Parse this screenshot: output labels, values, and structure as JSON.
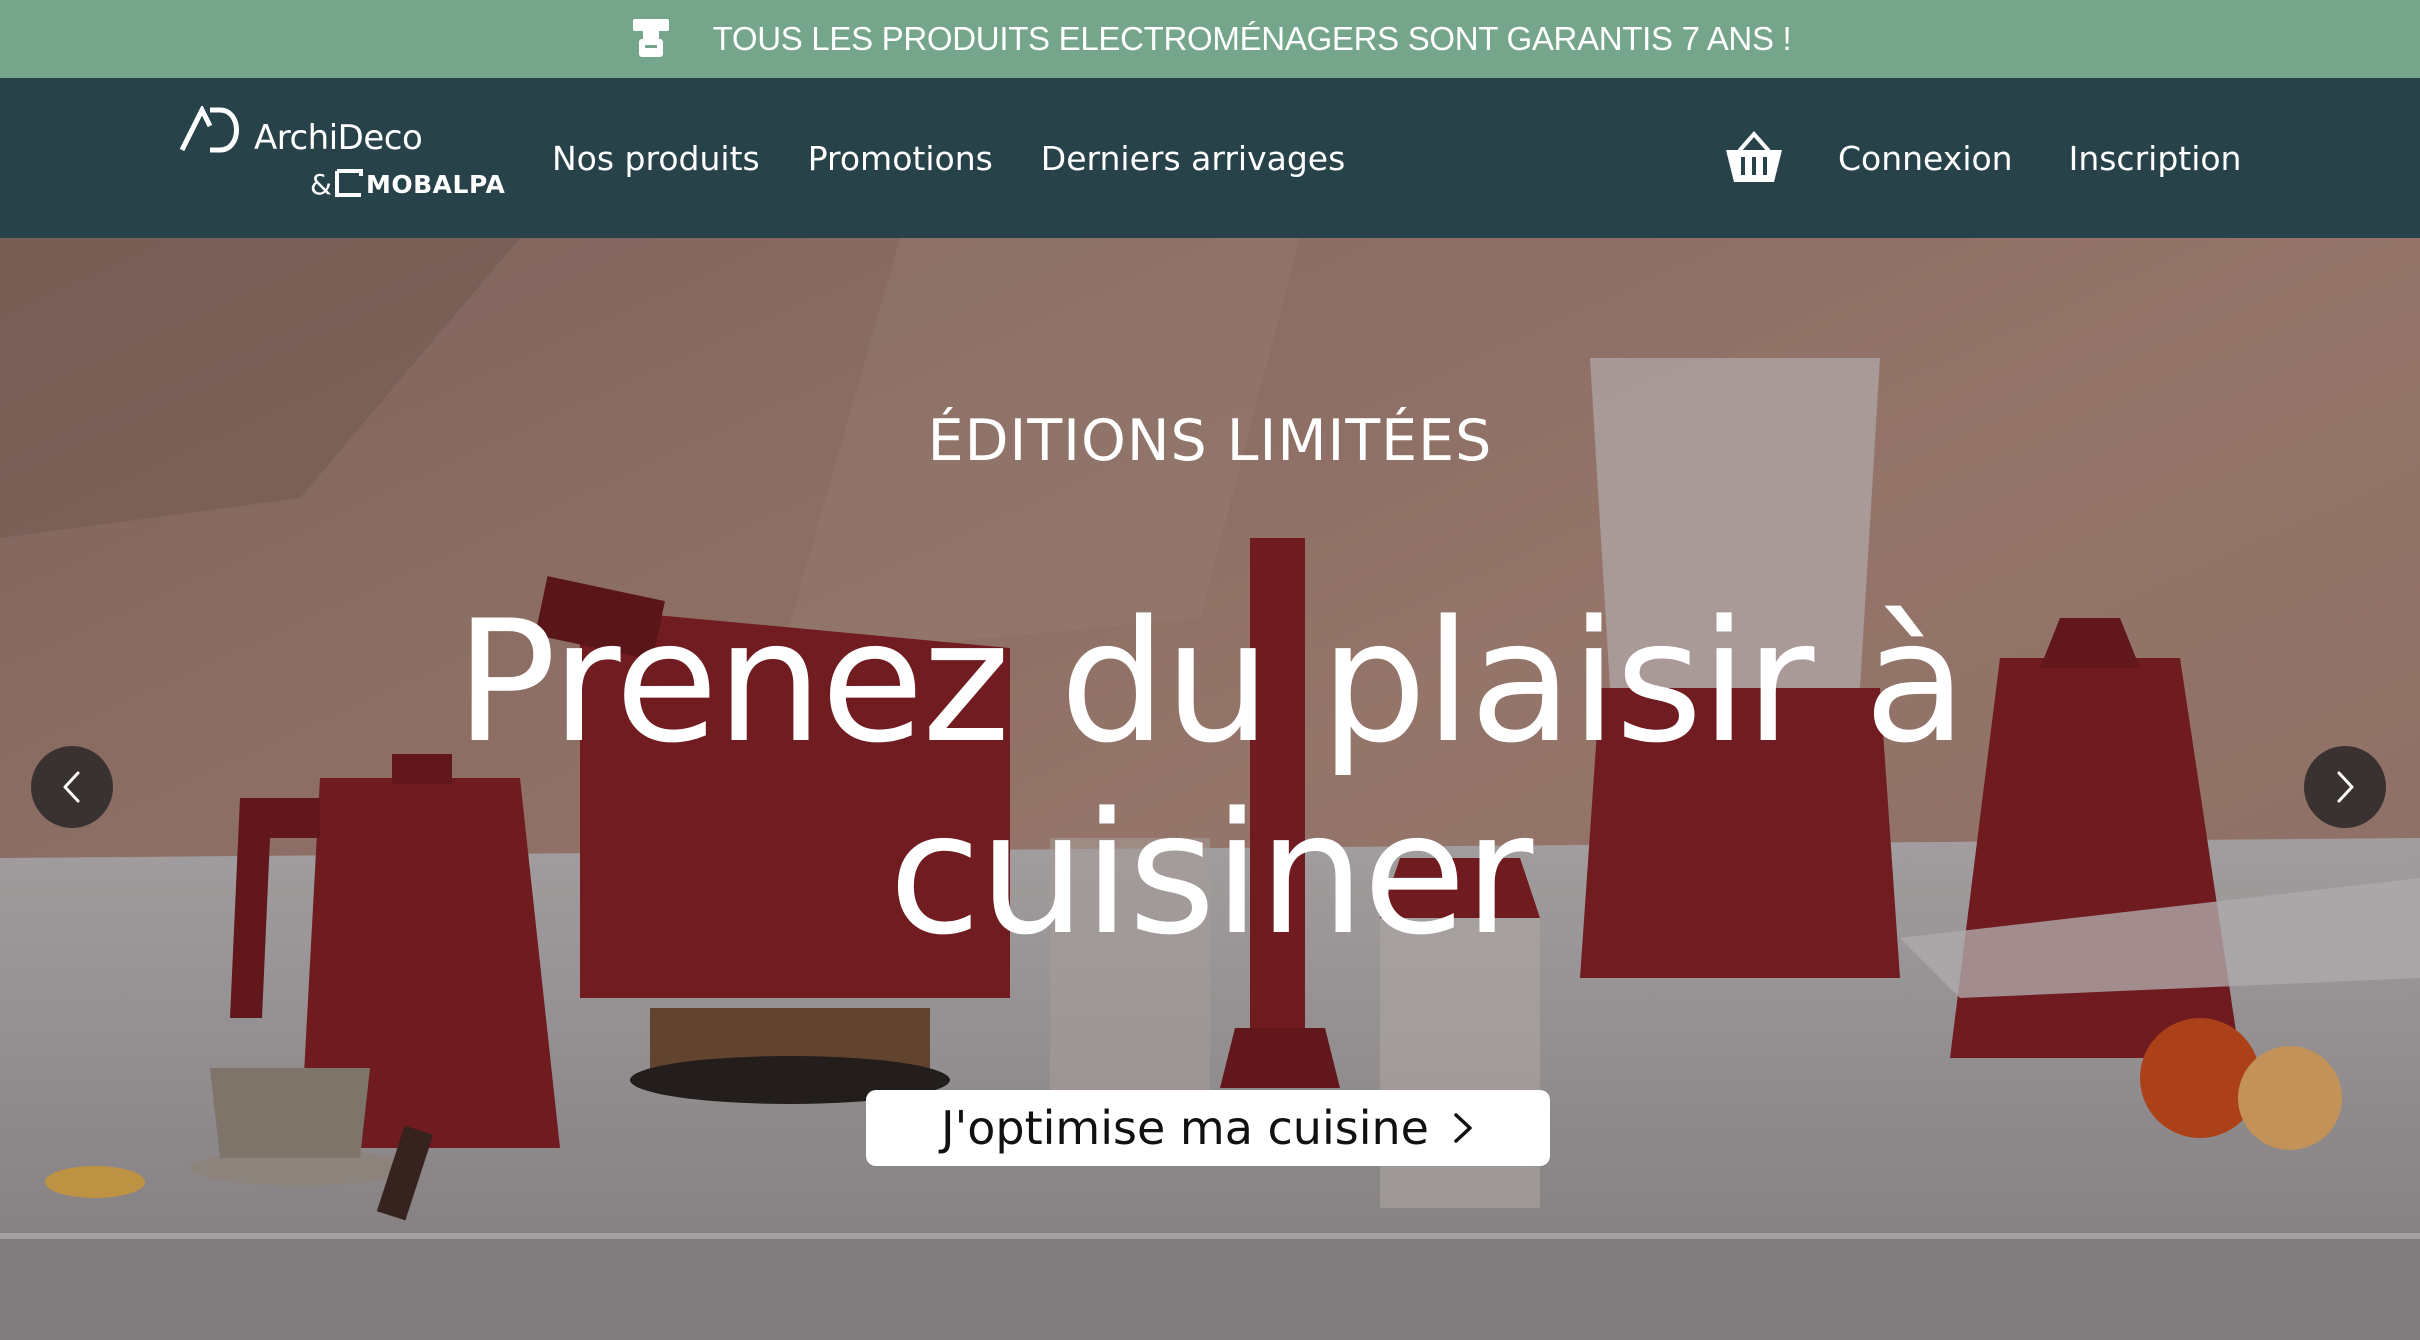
{
  "colors": {
    "topbar": "#75a58a",
    "nav": "#28424a",
    "text": "#ffffff"
  },
  "announcement": {
    "icon": "appliance-icon",
    "text": "TOUS LES PRODUITS ELECTROMÉNAGERS SONT GARANTIS 7 ANS !"
  },
  "header": {
    "logo": {
      "mark": "AD",
      "name": "ArchiDeco",
      "amp": "&",
      "partner": "MOBALPA"
    },
    "nav": [
      "Nos produits",
      "Promotions",
      "Derniers arrivages"
    ],
    "cart_icon": "basket-icon",
    "auth": {
      "login": "Connexion",
      "register": "Inscription"
    }
  },
  "hero": {
    "eyebrow": "ÉDITIONS LIMITÉES",
    "headline_line1": "Prenez du plaisir à",
    "headline_line2": "cuisiner",
    "cta_label": "J'optimise ma cuisine",
    "cta_icon": "chevron-right-icon",
    "prev_icon": "chevron-left-icon",
    "next_icon": "chevron-right-icon"
  }
}
